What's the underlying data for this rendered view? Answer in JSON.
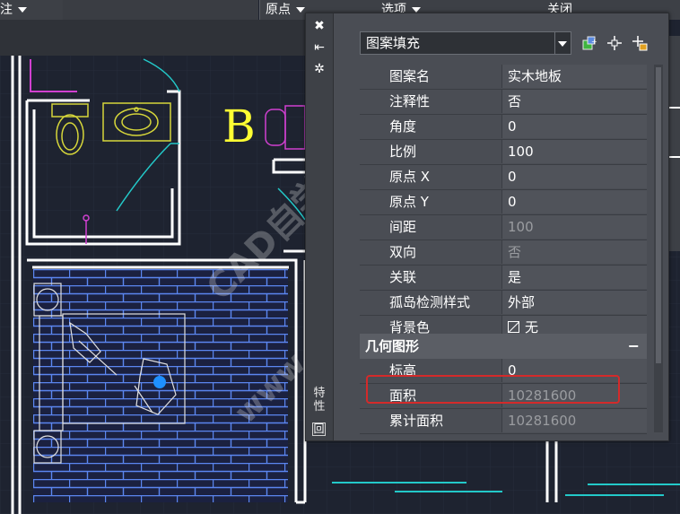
{
  "toolbar": {
    "left_item": "注",
    "origin_label": "原点",
    "options_label": "选项",
    "close_label": "关闭"
  },
  "drawing": {
    "room_label": "B"
  },
  "palette": {
    "sidebar_title": "特性",
    "selector_value": "图案填充",
    "pattern_rows": [
      {
        "label": "图案名",
        "value": "实木地板",
        "enabled": true
      },
      {
        "label": "注释性",
        "value": "否",
        "enabled": true
      },
      {
        "label": "角度",
        "value": "0",
        "enabled": true
      },
      {
        "label": "比例",
        "value": "100",
        "enabled": true
      },
      {
        "label": "原点 X",
        "value": "0",
        "enabled": true
      },
      {
        "label": "原点 Y",
        "value": "0",
        "enabled": true
      },
      {
        "label": "间距",
        "value": "100",
        "enabled": false
      },
      {
        "label": "双向",
        "value": "否",
        "enabled": false
      },
      {
        "label": "关联",
        "value": "是",
        "enabled": true
      },
      {
        "label": "孤岛检测样式",
        "value": "外部",
        "enabled": true
      },
      {
        "label": "背景色",
        "value": "无",
        "enabled": true
      }
    ],
    "geometry_section": "几何图形",
    "collapse_symbol": "−",
    "geometry_rows": [
      {
        "label": "标高",
        "value": "0",
        "enabled": true
      },
      {
        "label": "面积",
        "value": "10281600",
        "enabled": false
      },
      {
        "label": "累计面积",
        "value": "10281600",
        "enabled": false
      }
    ]
  },
  "watermark": {
    "line1": "CAD自学网",
    "line2": "www.cadzxw.com"
  },
  "colors": {
    "cad_background": "#1e2330",
    "wall": "#ffffff",
    "floor_hatch": "#4f79e8",
    "highlight": "#d42a2a"
  }
}
